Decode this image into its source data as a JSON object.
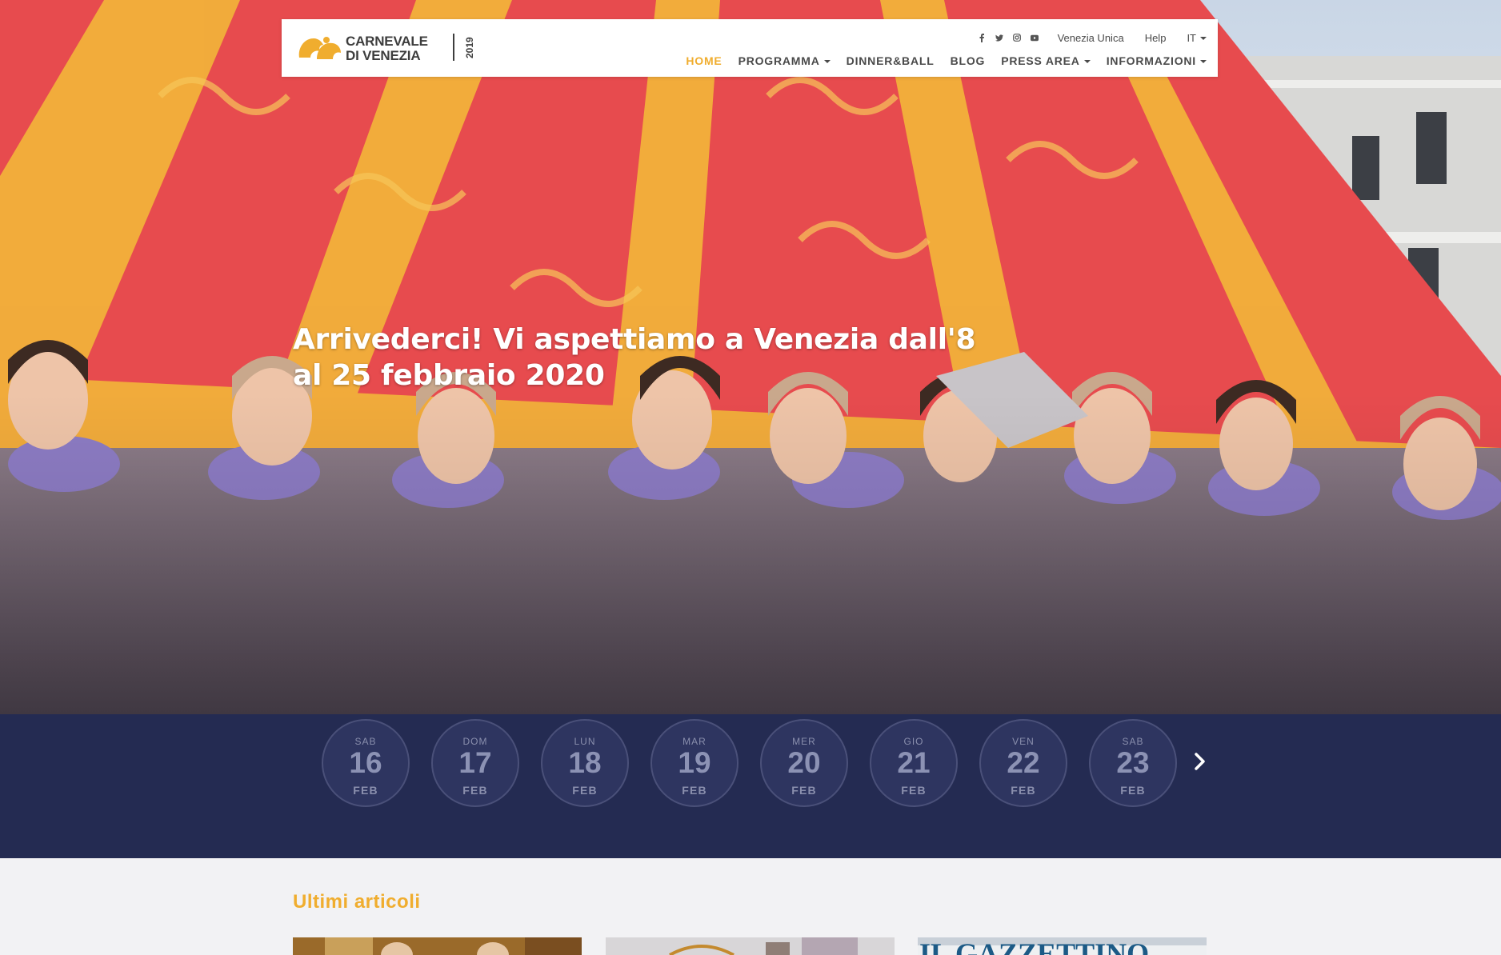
{
  "brand": {
    "name_line1": "CARNEVALE",
    "name_line2": "DI VENEZIA",
    "year": "2019",
    "accent_color": "#f0ad2e",
    "dark_color": "#242b52"
  },
  "utility_nav": {
    "social": [
      "facebook-icon",
      "twitter-icon",
      "instagram-icon",
      "youtube-icon"
    ],
    "links": [
      "Venezia Unica",
      "Help"
    ],
    "language": "IT"
  },
  "main_nav": [
    {
      "label": "HOME",
      "active": true,
      "dropdown": false
    },
    {
      "label": "PROGRAMMA",
      "active": false,
      "dropdown": true
    },
    {
      "label": "DINNER&BALL",
      "active": false,
      "dropdown": false
    },
    {
      "label": "BLOG",
      "active": false,
      "dropdown": false
    },
    {
      "label": "PRESS AREA",
      "active": false,
      "dropdown": true
    },
    {
      "label": "INFORMAZIONI",
      "active": false,
      "dropdown": true
    }
  ],
  "hero": {
    "title": "Arrivederci! Vi aspettiamo a Venezia dall'8 al 25 febbraio 2020"
  },
  "calendar": {
    "days": [
      {
        "dow": "SAB",
        "num": "16",
        "mon": "FEB"
      },
      {
        "dow": "DOM",
        "num": "17",
        "mon": "FEB"
      },
      {
        "dow": "LUN",
        "num": "18",
        "mon": "FEB"
      },
      {
        "dow": "MAR",
        "num": "19",
        "mon": "FEB"
      },
      {
        "dow": "MER",
        "num": "20",
        "mon": "FEB"
      },
      {
        "dow": "GIO",
        "num": "21",
        "mon": "FEB"
      },
      {
        "dow": "VEN",
        "num": "22",
        "mon": "FEB"
      },
      {
        "dow": "SAB",
        "num": "23",
        "mon": "FEB"
      }
    ],
    "next_icon": "chevron-right-icon"
  },
  "articles": {
    "heading": "Ultimi articoli",
    "cards": [
      {
        "thumb": "article-thumb-1"
      },
      {
        "thumb": "article-thumb-2"
      },
      {
        "thumb": "article-thumb-3",
        "masthead": "IL GAZZETTINO"
      }
    ]
  }
}
